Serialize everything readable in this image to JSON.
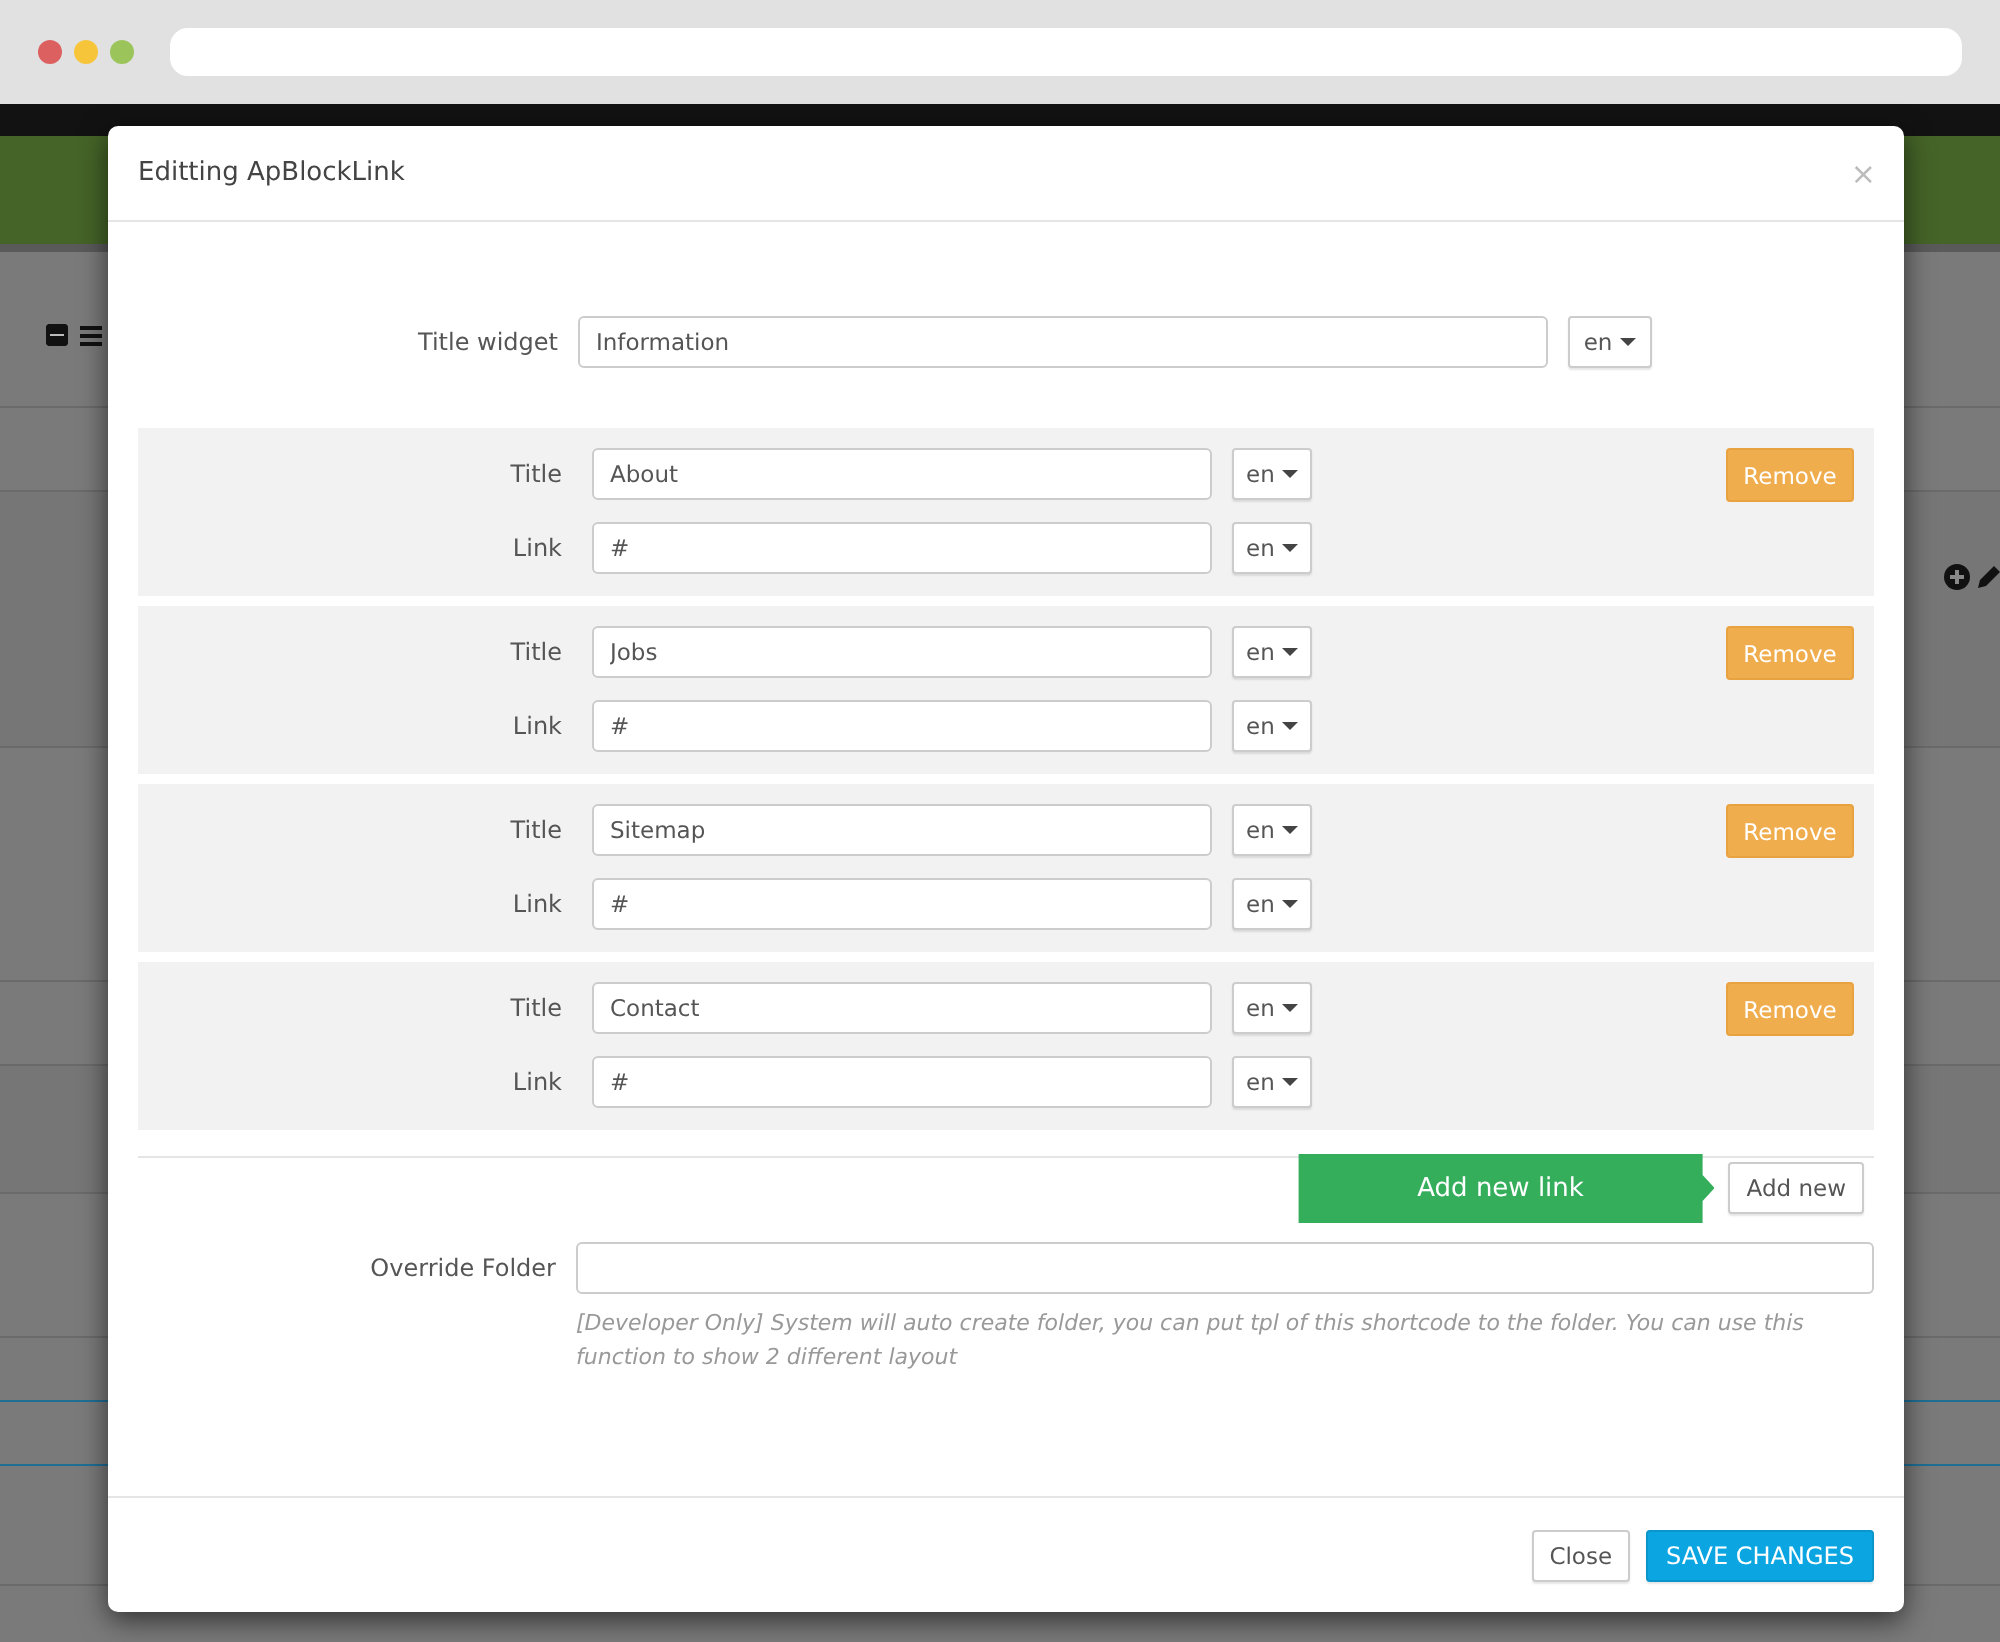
{
  "modal": {
    "title": "Editting ApBlockLink",
    "close": "×",
    "title_widget": {
      "label": "Title widget",
      "value": "Information",
      "lang": "en"
    },
    "links": [
      {
        "title_label": "Title",
        "title_value": "About",
        "title_lang": "en",
        "link_label": "Link",
        "link_value": "#",
        "link_lang": "en",
        "remove": "Remove"
      },
      {
        "title_label": "Title",
        "title_value": "Jobs",
        "title_lang": "en",
        "link_label": "Link",
        "link_value": "#",
        "link_lang": "en",
        "remove": "Remove"
      },
      {
        "title_label": "Title",
        "title_value": "Sitemap",
        "title_lang": "en",
        "link_label": "Link",
        "link_value": "#",
        "link_lang": "en",
        "remove": "Remove"
      },
      {
        "title_label": "Title",
        "title_value": "Contact",
        "title_lang": "en",
        "link_label": "Link",
        "link_value": "#",
        "link_lang": "en",
        "remove": "Remove"
      }
    ],
    "add_new": "Add new",
    "tooltip": "Add new link",
    "override_folder": {
      "label": "Override Folder",
      "help": "[Developer Only] System will auto create folder, you can put tpl of this shortcode to the folder. You can use this function to show 2 different layout"
    },
    "buttons": {
      "close": "Close",
      "save": "SAVE CHANGES"
    }
  }
}
